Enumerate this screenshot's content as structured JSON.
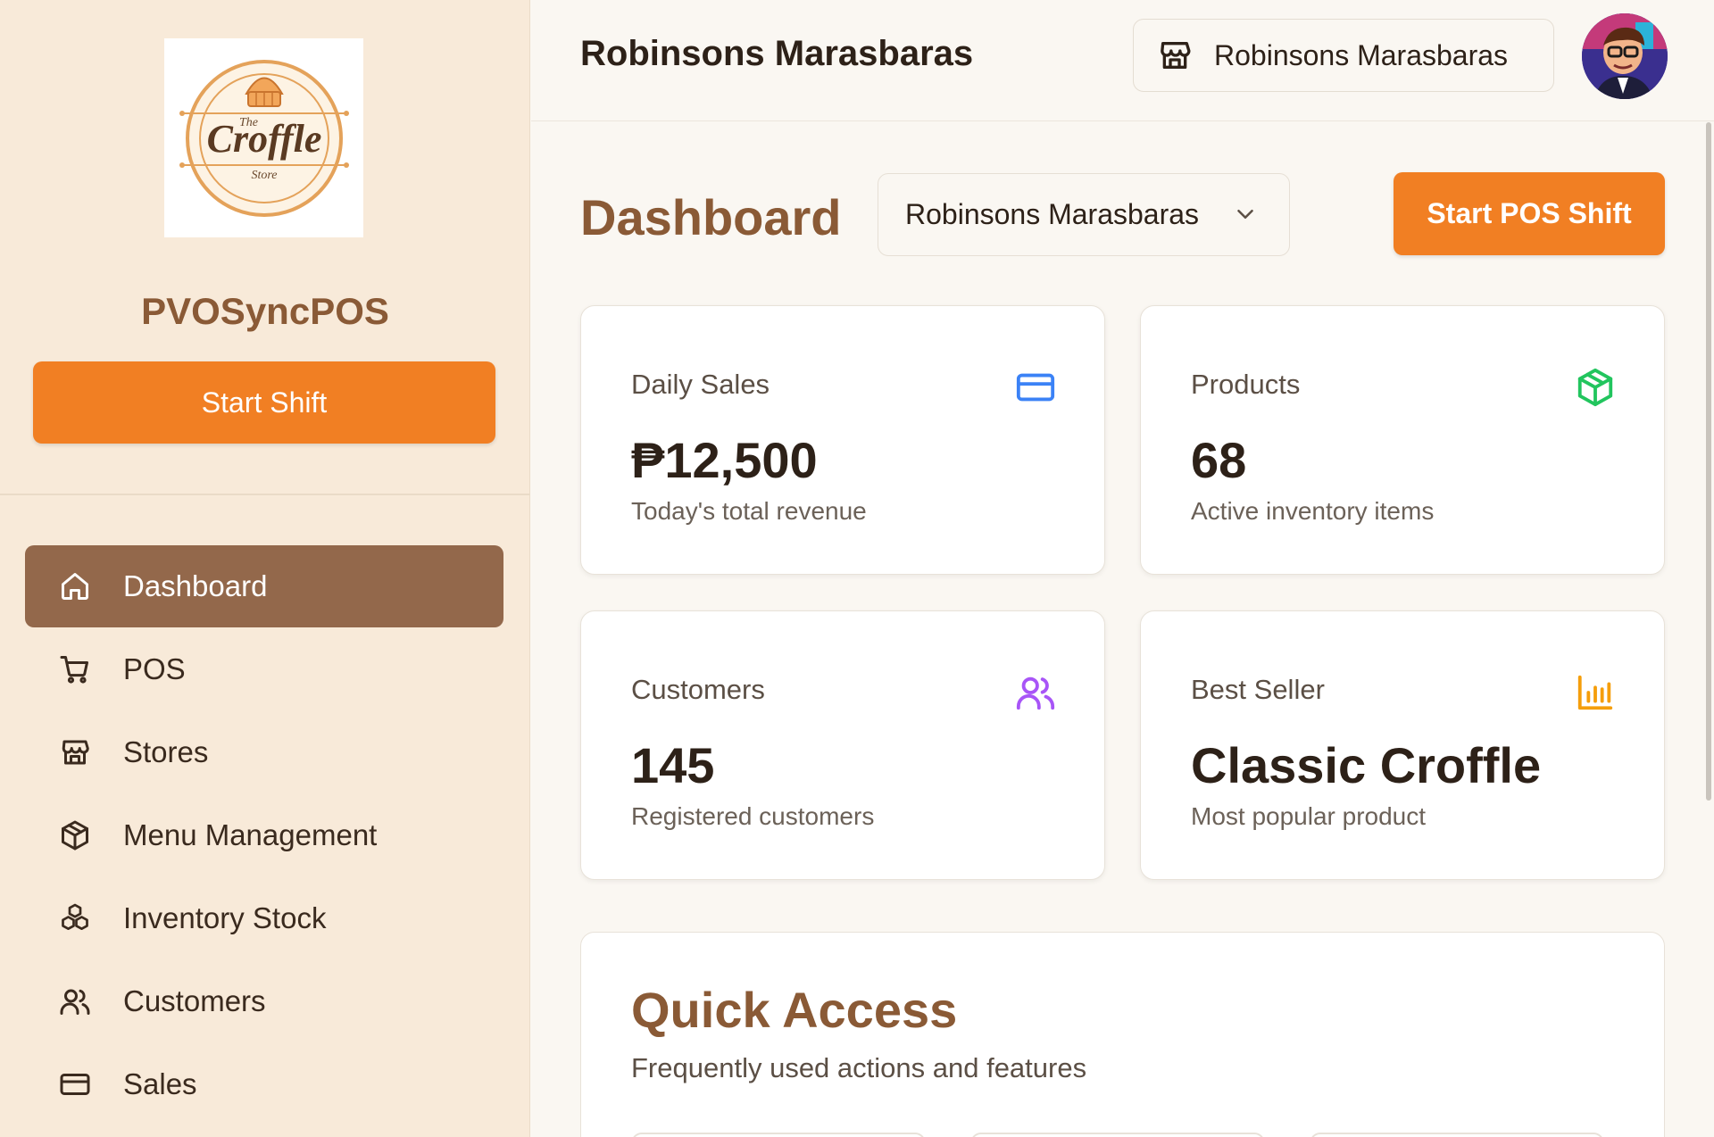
{
  "sidebar": {
    "logo": {
      "top_text": "The",
      "main_text": "Croffle",
      "bottom_text": "Store"
    },
    "app_name": "PVOSyncPOS",
    "start_shift_label": "Start Shift",
    "nav": [
      {
        "label": "Dashboard",
        "icon": "home-icon",
        "active": true
      },
      {
        "label": "POS",
        "icon": "cart-icon",
        "active": false
      },
      {
        "label": "Stores",
        "icon": "store-icon",
        "active": false
      },
      {
        "label": "Menu Management",
        "icon": "package-icon",
        "active": false
      },
      {
        "label": "Inventory Stock",
        "icon": "boxes-icon",
        "active": false
      },
      {
        "label": "Customers",
        "icon": "users-icon",
        "active": false
      },
      {
        "label": "Sales",
        "icon": "credit-card-icon",
        "active": false
      }
    ]
  },
  "header": {
    "title": "Robinsons Marasbaras",
    "store_chip": "Robinsons Marasbaras"
  },
  "main": {
    "page_title": "Dashboard",
    "store_select": "Robinsons Marasbaras",
    "start_pos_label": "Start POS Shift",
    "cards": [
      {
        "label": "Daily Sales",
        "value": "₱12,500",
        "sub": "Today's total revenue",
        "icon": "credit-card-icon",
        "color": "#3b82f6"
      },
      {
        "label": "Products",
        "value": "68",
        "sub": "Active inventory items",
        "icon": "package-icon",
        "color": "#22c55e"
      },
      {
        "label": "Customers",
        "value": "145",
        "sub": "Registered customers",
        "icon": "users-icon",
        "color": "#a855f7"
      },
      {
        "label": "Best Seller",
        "value": "Classic Croffle",
        "sub": "Most popular product",
        "icon": "bar-chart-icon",
        "color": "#f59e0b"
      }
    ],
    "quick_access": {
      "title": "Quick Access",
      "subtitle": "Frequently used actions and features"
    }
  },
  "colors": {
    "accent": "#f17f23",
    "brand_brown": "#8a5a36",
    "active_nav": "#93684b",
    "sidebar_bg": "#f8ead9"
  }
}
